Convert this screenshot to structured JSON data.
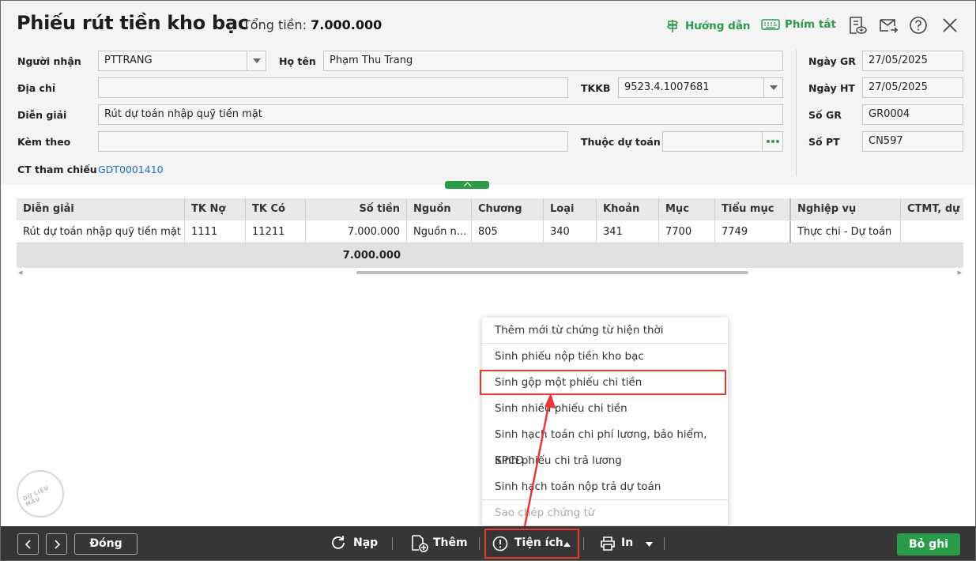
{
  "header": {
    "title": "Phiếu rút tiền kho bạc",
    "total_label": "Tổng tiền:",
    "total_value": "7.000.000",
    "guide_label": "Hướng dẫn",
    "shortcut_label": "Phím tắt"
  },
  "form": {
    "nguoi_nhan_label": "Người nhận",
    "nguoi_nhan_value": "PTTRANG",
    "ho_ten_label": "Họ tên",
    "ho_ten_value": "Phạm Thu Trang",
    "dia_chi_label": "Địa chỉ",
    "dia_chi_value": "",
    "tkkb_label": "TKKB",
    "tkkb_value": "9523.4.1007681",
    "dien_giai_label": "Diễn giải",
    "dien_giai_value": "Rút dự toán nhập quỹ tiền mặt",
    "kem_theo_label": "Kèm theo",
    "kem_theo_value": "",
    "thuoc_du_toan_label": "Thuộc dự toán",
    "thuoc_du_toan_value": "",
    "ct_tham_chieu_label": "CT tham chiếu",
    "ct_tham_chieu_value": "GDT0001410",
    "ngay_gr_label": "Ngày GR",
    "ngay_gr_value": "27/05/2025",
    "ngay_ht_label": "Ngày HT",
    "ngay_ht_value": "27/05/2025",
    "so_gr_label": "Số GR",
    "so_gr_value": "GR0004",
    "so_pt_label": "Số PT",
    "so_pt_value": "CN597"
  },
  "grid": {
    "columns": [
      "Diễn giải",
      "TK Nợ",
      "TK Có",
      "Số tiền",
      "Nguồn",
      "Chương",
      "Loại",
      "Khoản",
      "Mục",
      "Tiểu mục",
      "Nghiệp vụ",
      "CTMT, dự án"
    ],
    "rows": [
      [
        "Rút dự toán nhập quỹ tiền mặt",
        "1111",
        "11211",
        "7.000.000",
        "Nguồn n...",
        "805",
        "340",
        "341",
        "7700",
        "7749",
        "Thực chi - Dự toán",
        ""
      ]
    ],
    "total": "7.000.000"
  },
  "menu": {
    "items": [
      "Thêm mới từ chứng từ hiện thời",
      "Sinh phiếu nộp tiền kho bạc",
      "Sinh gộp một phiếu chi tiền",
      "Sinh nhiều phiếu chi tiền",
      "Sinh hạch toán chi phí lương, bảo hiểm, KPCĐ",
      "Sinh phiếu chi trả lương",
      "Sinh hạch toán nộp trả dự toán",
      "Sao chép chứng từ"
    ],
    "highlighted_index": 2,
    "disabled_index": 7
  },
  "watermark": "DỮ LIỆU MẪU",
  "footer": {
    "close_label": "Đóng",
    "reload_label": "Nạp",
    "add_label": "Thêm",
    "utility_label": "Tiện ích",
    "print_label": "In",
    "save_label": "Bỏ ghi"
  },
  "colors": {
    "accent": "#2a9b48",
    "highlight": "#e53935",
    "footer_bg": "#363636",
    "link": "#1e6fc9"
  }
}
